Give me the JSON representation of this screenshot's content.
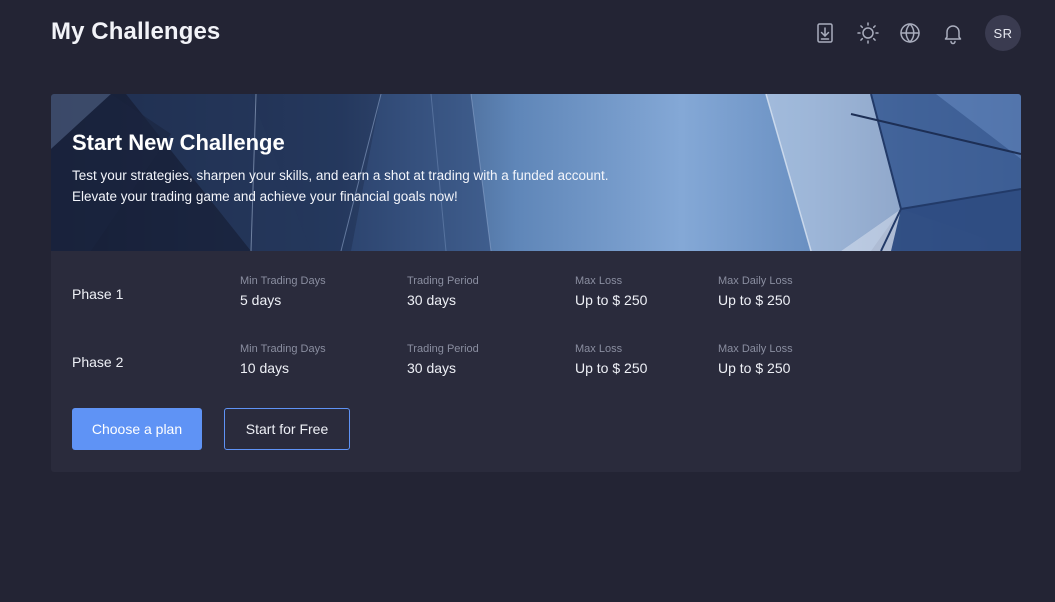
{
  "header": {
    "title": "My Challenges",
    "icons": [
      "download-icon",
      "sun-icon",
      "globe-icon",
      "bell-icon"
    ],
    "avatar_initials": "SR"
  },
  "banner": {
    "title": "Start New Challenge",
    "description_line1": "Test your strategies, sharpen your skills, and earn a shot at trading with a funded account.",
    "description_line2": "Elevate your trading game and achieve your financial goals now!"
  },
  "phases": [
    {
      "label": "Phase 1",
      "stats": [
        {
          "label": "Min Trading Days",
          "value": "5 days"
        },
        {
          "label": "Trading Period",
          "value": "30 days"
        },
        {
          "label": "Max Loss",
          "value": "Up to $ 250"
        },
        {
          "label": "Max Daily Loss",
          "value": "Up to $ 250"
        }
      ]
    },
    {
      "label": "Phase 2",
      "stats": [
        {
          "label": "Min Trading Days",
          "value": "10 days"
        },
        {
          "label": "Trading Period",
          "value": "30 days"
        },
        {
          "label": "Max Loss",
          "value": "Up to $ 250"
        },
        {
          "label": "Max Daily Loss",
          "value": "Up to $ 250"
        }
      ]
    }
  ],
  "actions": {
    "primary_label": "Choose a plan",
    "secondary_label": "Start for Free"
  },
  "colors": {
    "background": "#232434",
    "card": "#2a2b3c",
    "accent": "#5f93f5"
  }
}
